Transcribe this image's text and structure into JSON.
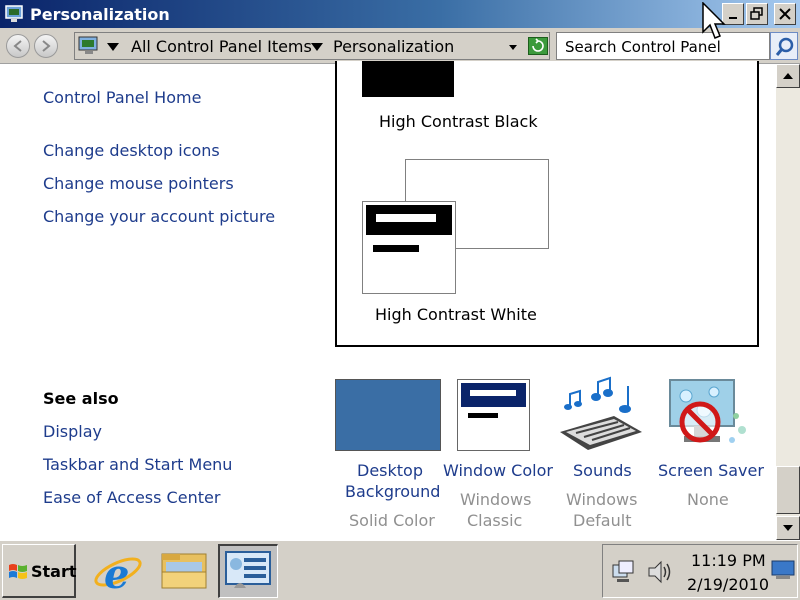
{
  "window": {
    "title": "Personalization"
  },
  "address": {
    "crumbs": [
      "All Control Panel Items",
      "Personalization"
    ]
  },
  "search": {
    "placeholder": "Search Control Panel"
  },
  "sidebar": {
    "home": "Control Panel Home",
    "tasks": [
      "Change desktop icons",
      "Change mouse pointers",
      "Change your account picture"
    ],
    "see_also_heading": "See also",
    "see_also": [
      "Display",
      "Taskbar and Start Menu",
      "Ease of Access Center"
    ]
  },
  "themes": {
    "items": [
      "High Contrast Black",
      "High Contrast White"
    ]
  },
  "tiles": [
    {
      "title": "Desktop\nBackground",
      "title_lines": [
        "Desktop",
        "Background"
      ],
      "sub": "Solid Color",
      "color": "#3a6ea5"
    },
    {
      "title_lines": [
        "Window Color"
      ],
      "sub_lines": [
        "Windows",
        "Classic"
      ]
    },
    {
      "title_lines": [
        "Sounds"
      ],
      "sub_lines": [
        "Windows",
        "Default"
      ]
    },
    {
      "title_lines": [
        "Screen Saver"
      ],
      "sub_lines": [
        "None"
      ]
    }
  ],
  "taskbar": {
    "start_label": "Start",
    "time": "11:19 PM",
    "date": "2/19/2010"
  },
  "icons": {
    "title": "control-panel-icon",
    "minimize": "minimize-icon",
    "restore": "restore-icon",
    "close": "close-icon",
    "back": "back-arrow-icon",
    "forward": "forward-arrow-icon",
    "search": "magnifier-icon",
    "ie": "internet-explorer-icon",
    "explorer": "folder-icon",
    "network": "network-icon",
    "volume": "speaker-icon"
  }
}
